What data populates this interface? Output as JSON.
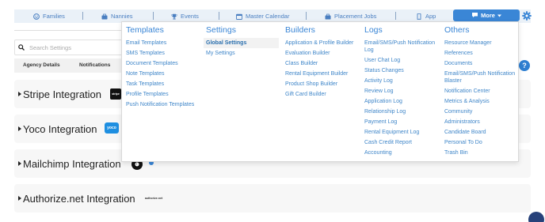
{
  "nav": {
    "items": [
      {
        "label": "Families",
        "icon": "families-icon"
      },
      {
        "label": "Nannies",
        "icon": "briefcase-icon"
      },
      {
        "label": "Events",
        "icon": "trophy-icon"
      },
      {
        "label": "Master Calendar",
        "icon": "calendar-icon"
      },
      {
        "label": "Placement Jobs",
        "icon": "briefcase-icon"
      },
      {
        "label": "App",
        "icon": "phone-icon"
      }
    ],
    "more_label": "More",
    "accent": "#3a86d6"
  },
  "sidebar": {
    "search_placeholder": "Search Settings",
    "tabs": [
      "Agency Details",
      "Notifications"
    ]
  },
  "dropdown": {
    "columns": [
      {
        "heading": "Templates",
        "items": [
          "Email Templates",
          "SMS Templates",
          "Document Templates",
          "Note Templates",
          "Task Templates",
          "Profile Templates",
          "Push Notification Templates"
        ]
      },
      {
        "heading": "Settings",
        "items": [
          "Global Settings",
          "My Settings"
        ],
        "active_index": 0
      },
      {
        "heading": "Builders",
        "items": [
          "Application & Profile Builder",
          "Evaluation Builder",
          "Class Builder",
          "Rental Equipment Builder",
          "Product Shop Builder",
          "Gift Card Builder"
        ]
      },
      {
        "heading": "Logs",
        "items": [
          "Email/SMS/Push Notification Log",
          "User Chat Log",
          "Status Changes",
          "Activity Log",
          "Review Log",
          "Application Log",
          "Relationship Log",
          "Payment Log",
          "Rental Equipment Log",
          "Cash Credit Report",
          "Accounting"
        ]
      },
      {
        "heading": "Others",
        "items": [
          "Resource Manager",
          "References",
          "Documents",
          "Email/SMS/Push Notification Blaster",
          "Notification Center",
          "Metrics & Analysis",
          "Community",
          "Administrators",
          "Candidate Board",
          "Personal To Do",
          "Trash Bin"
        ]
      }
    ]
  },
  "integrations": [
    {
      "title": "Stripe Integration",
      "logo_text": "stripe"
    },
    {
      "title": "Yoco Integration",
      "logo_text": "yoco"
    },
    {
      "title": "Mailchimp Integration",
      "logo_text": ""
    },
    {
      "title": "Authorize.net Integration",
      "logo_text": "authorize.net"
    }
  ]
}
